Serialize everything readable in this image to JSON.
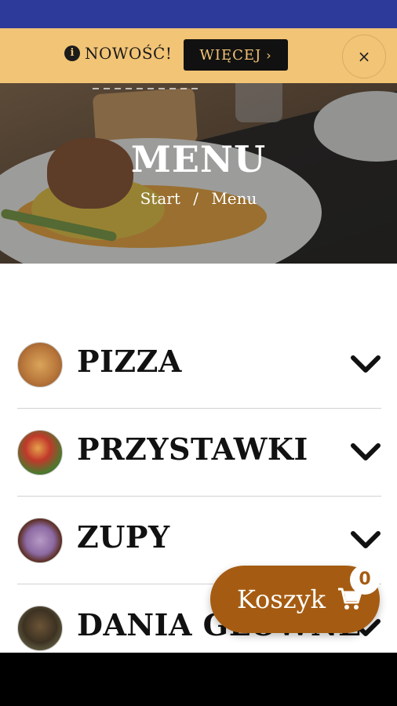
{
  "promo": {
    "info_icon": "info-icon",
    "text": "NOWOŚĆ!",
    "button_label": "WIĘCEJ",
    "button_chevron": "›",
    "close_icon": "×"
  },
  "hero": {
    "title": "MENU",
    "breadcrumb": {
      "home": "Start",
      "separator": "/",
      "current": "Menu"
    }
  },
  "categories": [
    {
      "label": "PIZZA"
    },
    {
      "label": "PRZYSTAWKI"
    },
    {
      "label": "ZUPY"
    },
    {
      "label": "DANIA GŁÓWNE"
    }
  ],
  "cart": {
    "label": "Koszyk",
    "count": "0",
    "icon": "cart-icon"
  },
  "colors": {
    "status_bar": "#2e3a9a",
    "promo_bg": "#f2c475",
    "accent": "#a55c12"
  }
}
